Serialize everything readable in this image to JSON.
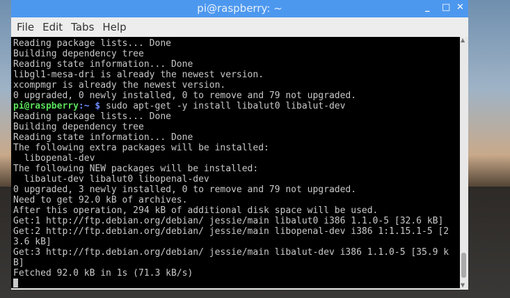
{
  "window": {
    "title": "pi@raspberry: ~"
  },
  "menu": [
    "File",
    "Edit",
    "Tabs",
    "Help"
  ],
  "prompt": {
    "user": "pi@raspberry",
    "path": ":~ $",
    "command": " sudo apt-get -y install libalut0 libalut-dev"
  },
  "lines_before": [
    "Reading package lists... Done",
    "Building dependency tree",
    "Reading state information... Done",
    "libgl1-mesa-dri is already the newest version.",
    "xcompmgr is already the newest version.",
    "0 upgraded, 0 newly installed, 0 to remove and 79 not upgraded."
  ],
  "lines_after": [
    "Reading package lists... Done",
    "Building dependency tree",
    "Reading state information... Done",
    "The following extra packages will be installed:",
    "  libopenal-dev",
    "The following NEW packages will be installed:",
    "  libalut-dev libalut0 libopenal-dev",
    "0 upgraded, 3 newly installed, 0 to remove and 79 not upgraded.",
    "Need to get 92.0 kB of archives.",
    "After this operation, 294 kB of additional disk space will be used.",
    "Get:1 http://ftp.debian.org/debian/ jessie/main libalut0 i386 1.1.0-5 [32.6 kB]",
    "Get:2 http://ftp.debian.org/debian/ jessie/main libopenal-dev i386 1:1.15.1-5 [2",
    "3.6 kB]",
    "Get:3 http://ftp.debian.org/debian/ jessie/main libalut-dev i386 1.1.0-5 [35.9 k",
    "B]",
    "Fetched 92.0 kB in 1s (71.3 kB/s)"
  ]
}
